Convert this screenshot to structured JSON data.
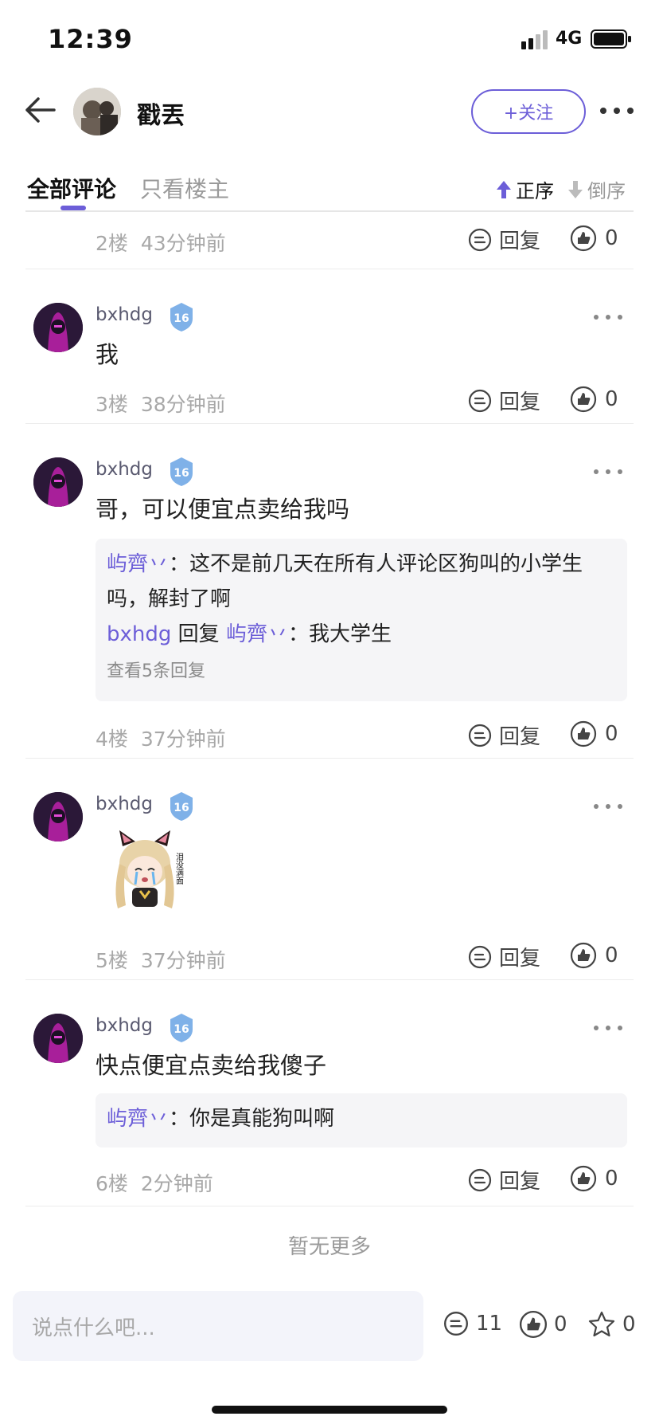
{
  "status_bar": {
    "time": "12:39",
    "network": "4G"
  },
  "header": {
    "title": "戳丟",
    "follow_label": "+关注"
  },
  "tabs": {
    "all_label": "全部评论",
    "owner_label": "只看楼主",
    "asc_label": "正序",
    "desc_label": "倒序"
  },
  "comments": [
    {
      "floor": "2楼",
      "time": "43分钟前",
      "reply_label": "回复",
      "likes": "0"
    },
    {
      "name": "bxhdg",
      "level": "16",
      "text": "我",
      "floor": "3楼",
      "time": "38分钟前",
      "reply_label": "回复",
      "likes": "0"
    },
    {
      "name": "bxhdg",
      "level": "16",
      "text": "哥，可以便宜点卖给我吗",
      "floor": "4楼",
      "time": "37分钟前",
      "reply_label": "回复",
      "likes": "0",
      "subreplies": {
        "r1_user": "屿齊丷",
        "r1_sep": "：",
        "r1_text": "这不是前几天在所有人评论区狗叫的小学生吗，解封了啊",
        "r2_user": "bxhdg",
        "r2_mid": "回复",
        "r2_target": "屿齊丷",
        "r2_sep": "：",
        "r2_text": "我大学生",
        "view_more": "查看5条回复"
      }
    },
    {
      "name": "bxhdg",
      "level": "16",
      "sticker_text": "泪没满面",
      "floor": "5楼",
      "time": "37分钟前",
      "reply_label": "回复",
      "likes": "0"
    },
    {
      "name": "bxhdg",
      "level": "16",
      "text": "快点便宜点卖给我傻子",
      "floor": "6楼",
      "time": "2分钟前",
      "reply_label": "回复",
      "likes": "0",
      "subreplies": {
        "r1_user": "屿齊丷",
        "r1_sep": "：",
        "r1_text": "你是真能狗叫啊"
      }
    }
  ],
  "no_more": "暂无更多",
  "bottom": {
    "placeholder": "说点什么吧...",
    "comments": "11",
    "likes": "0",
    "favorites": "0"
  },
  "colors": {
    "accent": "#6c5ed8",
    "muted": "#a8a8a8"
  }
}
